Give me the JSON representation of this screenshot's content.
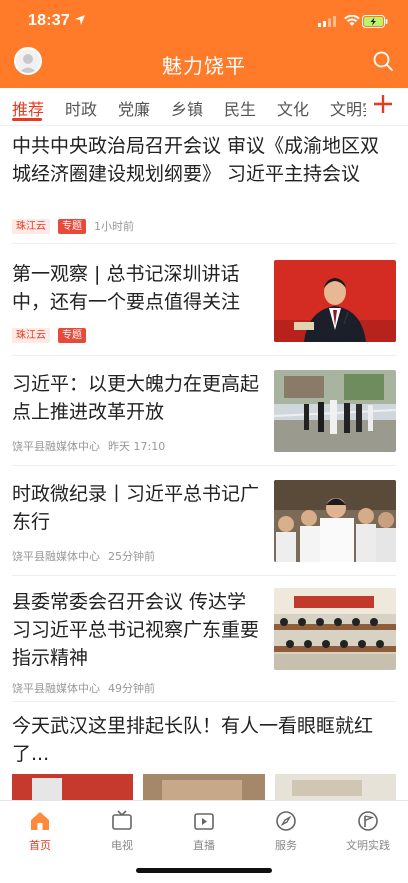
{
  "status": {
    "time": "18:37"
  },
  "navbar": {
    "title": "魅力饶平"
  },
  "tabs": [
    "推荐",
    "时政",
    "党廉",
    "乡镇",
    "民生",
    "文化",
    "文明实"
  ],
  "feed": [
    {
      "title": "中共中央政治局召开会议 审议《成渝地区双城经济圈建设规划纲要》 习近平主持会议",
      "source": "珠江云",
      "tag": "专题",
      "time": "1小时前"
    },
    {
      "title": "第一观察 | 总书记深圳讲话中，还有一个要点值得关注",
      "source": "珠江云",
      "tag": "专题",
      "time": ""
    },
    {
      "title": "习近平：以更大魄力在更高起点上推进改革开放",
      "source": "饶平县融媒体中心",
      "time": "昨天 17:10"
    },
    {
      "title": "时政微纪录丨习近平总书记广东行",
      "source": "饶平县融媒体中心",
      "time": "25分钟前"
    },
    {
      "title": "县委常委会召开会议 传达学习习近平总书记视察广东重要指示精神",
      "source": "饶平县融媒体中心",
      "time": "49分钟前"
    },
    {
      "title": "今天武汉这里排起长队！有人一看眼眶就红了..."
    }
  ],
  "tabbar": [
    {
      "label": "首页",
      "icon": "home-icon"
    },
    {
      "label": "电视",
      "icon": "tv-icon"
    },
    {
      "label": "直播",
      "icon": "live-icon"
    },
    {
      "label": "服务",
      "icon": "compass-icon"
    },
    {
      "label": "文明实践",
      "icon": "flag-icon"
    }
  ],
  "colors": {
    "brand": "#ff7a29",
    "accent": "#e8391f"
  }
}
